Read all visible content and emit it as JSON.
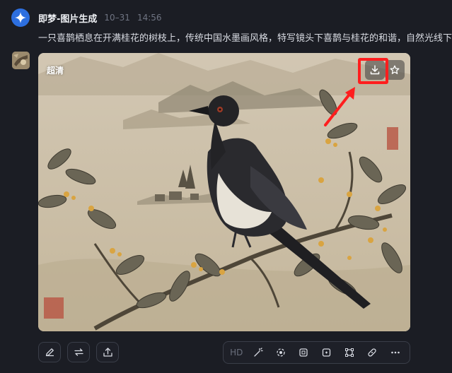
{
  "bot": {
    "name": "即梦-图片生成",
    "date": "10–31",
    "time": "14:56"
  },
  "prompt_text": "一只喜鹊栖息在开满桂花的树枝上，传统中国水墨画风格，特写镜头下喜鹊与桂花的和谐，自然光线下",
  "image": {
    "quality_label": "超清"
  },
  "image_actions": [
    {
      "icon": "download-icon"
    },
    {
      "icon": "star-icon"
    }
  ],
  "annotation": {
    "color": "#ff1e1e"
  },
  "bottom_left_tools": [
    {
      "icon": "edit-pencil-icon"
    },
    {
      "icon": "regenerate-icon"
    },
    {
      "icon": "share-icon"
    }
  ],
  "bottom_right_tools": {
    "hd_label": "HD",
    "icons": [
      "magic-wand-icon",
      "eraser-icon",
      "crop-expand-icon",
      "add-image-icon",
      "resize-icon",
      "patch-icon",
      "more-icon"
    ]
  }
}
